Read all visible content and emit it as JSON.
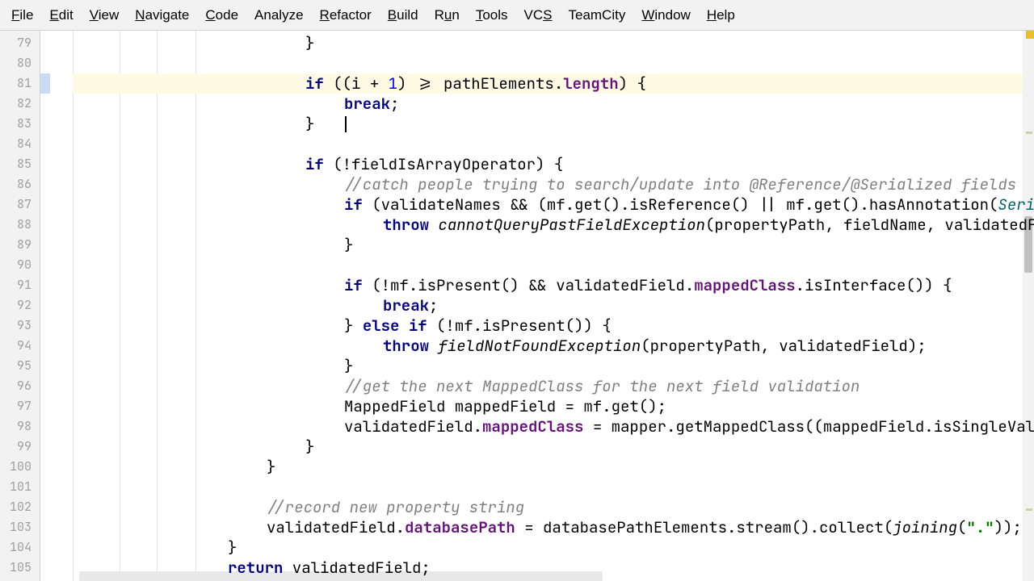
{
  "menu": {
    "items": [
      {
        "label": "File",
        "u": 0
      },
      {
        "label": "Edit",
        "u": 0
      },
      {
        "label": "View",
        "u": 0
      },
      {
        "label": "Navigate",
        "u": 0
      },
      {
        "label": "Code",
        "u": 0
      },
      {
        "label": "Analyze",
        "u": -1
      },
      {
        "label": "Refactor",
        "u": 0
      },
      {
        "label": "Build",
        "u": 0
      },
      {
        "label": "Run",
        "u": 1
      },
      {
        "label": "Tools",
        "u": 0
      },
      {
        "label": "VCS",
        "u": 2
      },
      {
        "label": "TeamCity",
        "u": -1
      },
      {
        "label": "Window",
        "u": 0
      },
      {
        "label": "Help",
        "u": 0
      }
    ]
  },
  "editor": {
    "first_line": 79,
    "last_line": 105,
    "highlighted_line": 81,
    "caret_line": 83,
    "indent_unit": "    ",
    "lines": [
      {
        "n": 79,
        "indent": 6,
        "tokens": [
          {
            "t": "}",
            "c": ""
          }
        ]
      },
      {
        "n": 80,
        "indent": 0,
        "tokens": []
      },
      {
        "n": 81,
        "indent": 6,
        "tokens": [
          {
            "t": "if",
            "c": "kw"
          },
          {
            "t": " ((i + ",
            "c": ""
          },
          {
            "t": "1",
            "c": "num"
          },
          {
            "t": ") >= pathElements.",
            "c": ""
          },
          {
            "t": "length",
            "c": "field"
          },
          {
            "t": ") {",
            "c": ""
          }
        ]
      },
      {
        "n": 82,
        "indent": 7,
        "tokens": [
          {
            "t": "break",
            "c": "kw"
          },
          {
            "t": ";",
            "c": ""
          }
        ]
      },
      {
        "n": 83,
        "indent": 6,
        "tokens": [
          {
            "t": "}",
            "c": ""
          }
        ]
      },
      {
        "n": 84,
        "indent": 0,
        "tokens": []
      },
      {
        "n": 85,
        "indent": 6,
        "tokens": [
          {
            "t": "if",
            "c": "kw"
          },
          {
            "t": " (!fieldIsArrayOperator) {",
            "c": ""
          }
        ]
      },
      {
        "n": 86,
        "indent": 7,
        "tokens": [
          {
            "t": "//catch people trying to search/update into @Reference/@Serialized fields",
            "c": "comment"
          }
        ]
      },
      {
        "n": 87,
        "indent": 7,
        "tokens": [
          {
            "t": "if",
            "c": "kw"
          },
          {
            "t": " (validateNames && (mf.get().isReference() || mf.get().hasAnnotation(",
            "c": ""
          },
          {
            "t": "Serializ",
            "c": "type-ref"
          }
        ]
      },
      {
        "n": 88,
        "indent": 8,
        "tokens": [
          {
            "t": "throw",
            "c": "kw"
          },
          {
            "t": " ",
            "c": ""
          },
          {
            "t": "cannotQueryPastFieldException",
            "c": "italic-call"
          },
          {
            "t": "(propertyPath, fieldName, validatedFiel",
            "c": ""
          }
        ]
      },
      {
        "n": 89,
        "indent": 7,
        "tokens": [
          {
            "t": "}",
            "c": ""
          }
        ]
      },
      {
        "n": 90,
        "indent": 0,
        "tokens": []
      },
      {
        "n": 91,
        "indent": 7,
        "tokens": [
          {
            "t": "if",
            "c": "kw"
          },
          {
            "t": " (!mf.isPresent() && validatedField.",
            "c": ""
          },
          {
            "t": "mappedClass",
            "c": "field"
          },
          {
            "t": ".isInterface()) {",
            "c": ""
          }
        ]
      },
      {
        "n": 92,
        "indent": 8,
        "tokens": [
          {
            "t": "break",
            "c": "kw"
          },
          {
            "t": ";",
            "c": ""
          }
        ]
      },
      {
        "n": 93,
        "indent": 7,
        "tokens": [
          {
            "t": "} ",
            "c": ""
          },
          {
            "t": "else if",
            "c": "kw"
          },
          {
            "t": " (!mf.isPresent()) {",
            "c": ""
          }
        ]
      },
      {
        "n": 94,
        "indent": 8,
        "tokens": [
          {
            "t": "throw",
            "c": "kw"
          },
          {
            "t": " ",
            "c": ""
          },
          {
            "t": "fieldNotFoundException",
            "c": "italic-call"
          },
          {
            "t": "(propertyPath, validatedField);",
            "c": ""
          }
        ]
      },
      {
        "n": 95,
        "indent": 7,
        "tokens": [
          {
            "t": "}",
            "c": ""
          }
        ]
      },
      {
        "n": 96,
        "indent": 7,
        "tokens": [
          {
            "t": "//get the next MappedClass for the next field validation",
            "c": "comment"
          }
        ]
      },
      {
        "n": 97,
        "indent": 7,
        "tokens": [
          {
            "t": "MappedField mappedField = mf.get();",
            "c": ""
          }
        ]
      },
      {
        "n": 98,
        "indent": 7,
        "tokens": [
          {
            "t": "validatedField.",
            "c": ""
          },
          {
            "t": "mappedClass",
            "c": "field"
          },
          {
            "t": " = mapper.getMappedClass((mappedField.isSingleValue(",
            "c": ""
          }
        ]
      },
      {
        "n": 99,
        "indent": 6,
        "tokens": [
          {
            "t": "}",
            "c": ""
          }
        ]
      },
      {
        "n": 100,
        "indent": 5,
        "tokens": [
          {
            "t": "}",
            "c": ""
          }
        ]
      },
      {
        "n": 101,
        "indent": 0,
        "tokens": []
      },
      {
        "n": 102,
        "indent": 5,
        "tokens": [
          {
            "t": "//record new property string",
            "c": "comment"
          }
        ]
      },
      {
        "n": 103,
        "indent": 5,
        "tokens": [
          {
            "t": "validatedField.",
            "c": ""
          },
          {
            "t": "databasePath",
            "c": "field"
          },
          {
            "t": " = databasePathElements.stream().collect(",
            "c": ""
          },
          {
            "t": "joining",
            "c": "static-call"
          },
          {
            "t": "(",
            "c": ""
          },
          {
            "t": "\".\"",
            "c": "str"
          },
          {
            "t": "));",
            "c": ""
          }
        ]
      },
      {
        "n": 104,
        "indent": 4,
        "tokens": [
          {
            "t": "}",
            "c": ""
          }
        ]
      },
      {
        "n": 105,
        "indent": 4,
        "tokens": [
          {
            "t": "return",
            "c": "kw"
          },
          {
            "t": " validatedField;",
            "c": ""
          }
        ]
      }
    ]
  }
}
